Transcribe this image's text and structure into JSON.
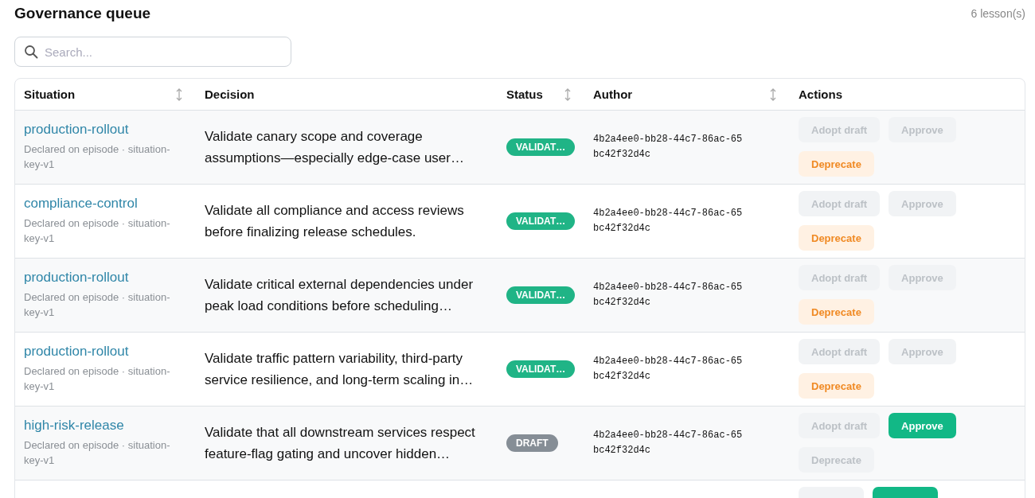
{
  "header": {
    "title": "Governance queue",
    "count": "6 lesson(s)"
  },
  "search": {
    "placeholder": "Search..."
  },
  "table": {
    "columns": [
      {
        "label": "Situation",
        "sortable": true
      },
      {
        "label": "Decision",
        "sortable": false
      },
      {
        "label": "Status",
        "sortable": true
      },
      {
        "label": "Author",
        "sortable": true
      },
      {
        "label": "Actions",
        "sortable": false
      }
    ],
    "rows": [
      {
        "situation": "production-rollout",
        "note": "Declared on episode · situation-key-v1",
        "decision": "Validate canary scope and coverage assumptions—especially edge-case user…",
        "status": {
          "label": "VALIDAT…",
          "color": "#20b486"
        },
        "author": "4b2a4ee0-bb28-44c7-86ac-65bc42f32d4c",
        "actions": [
          {
            "label": "Adopt draft",
            "kind": "neutral",
            "disabled": true
          },
          {
            "label": "Approve",
            "kind": "primary",
            "disabled": true
          },
          {
            "label": "Deprecate",
            "kind": "warning",
            "disabled": false
          }
        ]
      },
      {
        "situation": "compliance-control",
        "note": "Declared on episode · situation-key-v1",
        "decision": "Validate all compliance and access reviews before finalizing release schedules.",
        "status": {
          "label": "VALIDAT…",
          "color": "#20b486"
        },
        "author": "4b2a4ee0-bb28-44c7-86ac-65bc42f32d4c",
        "actions": [
          {
            "label": "Adopt draft",
            "kind": "neutral",
            "disabled": true
          },
          {
            "label": "Approve",
            "kind": "primary",
            "disabled": true
          },
          {
            "label": "Deprecate",
            "kind": "warning",
            "disabled": false
          }
        ]
      },
      {
        "situation": "production-rollout",
        "note": "Declared on episode · situation-key-v1",
        "decision": "Validate critical external dependencies under peak load conditions before scheduling…",
        "status": {
          "label": "VALIDAT…",
          "color": "#20b486"
        },
        "author": "4b2a4ee0-bb28-44c7-86ac-65bc42f32d4c",
        "actions": [
          {
            "label": "Adopt draft",
            "kind": "neutral",
            "disabled": true
          },
          {
            "label": "Approve",
            "kind": "primary",
            "disabled": true
          },
          {
            "label": "Deprecate",
            "kind": "warning",
            "disabled": false
          }
        ]
      },
      {
        "situation": "production-rollout",
        "note": "Declared on episode · situation-key-v1",
        "decision": "Validate traffic pattern variability, third-party service resilience, and long-term scaling in…",
        "status": {
          "label": "VALIDAT…",
          "color": "#20b486"
        },
        "author": "4b2a4ee0-bb28-44c7-86ac-65bc42f32d4c",
        "actions": [
          {
            "label": "Adopt draft",
            "kind": "neutral",
            "disabled": true
          },
          {
            "label": "Approve",
            "kind": "primary",
            "disabled": true
          },
          {
            "label": "Deprecate",
            "kind": "warning",
            "disabled": false
          }
        ]
      },
      {
        "situation": "high-risk-release",
        "note": "Declared on episode · situation-key-v1",
        "decision": "Validate that all downstream services respect feature-flag gating and uncover hidden…",
        "status": {
          "label": "DRAFT",
          "color": "#868e96"
        },
        "author": "4b2a4ee0-bb28-44c7-86ac-65bc42f32d4c",
        "actions": [
          {
            "label": "Adopt draft",
            "kind": "neutral",
            "disabled": true
          },
          {
            "label": "Approve",
            "kind": "primary",
            "disabled": false
          },
          {
            "label": "Deprecate",
            "kind": "warning",
            "disabled": true
          }
        ]
      },
      {
        "actions": [
          {
            "kind": "neutral",
            "disabled": true
          },
          {
            "kind": "primary",
            "disabled": false
          }
        ]
      }
    ]
  }
}
